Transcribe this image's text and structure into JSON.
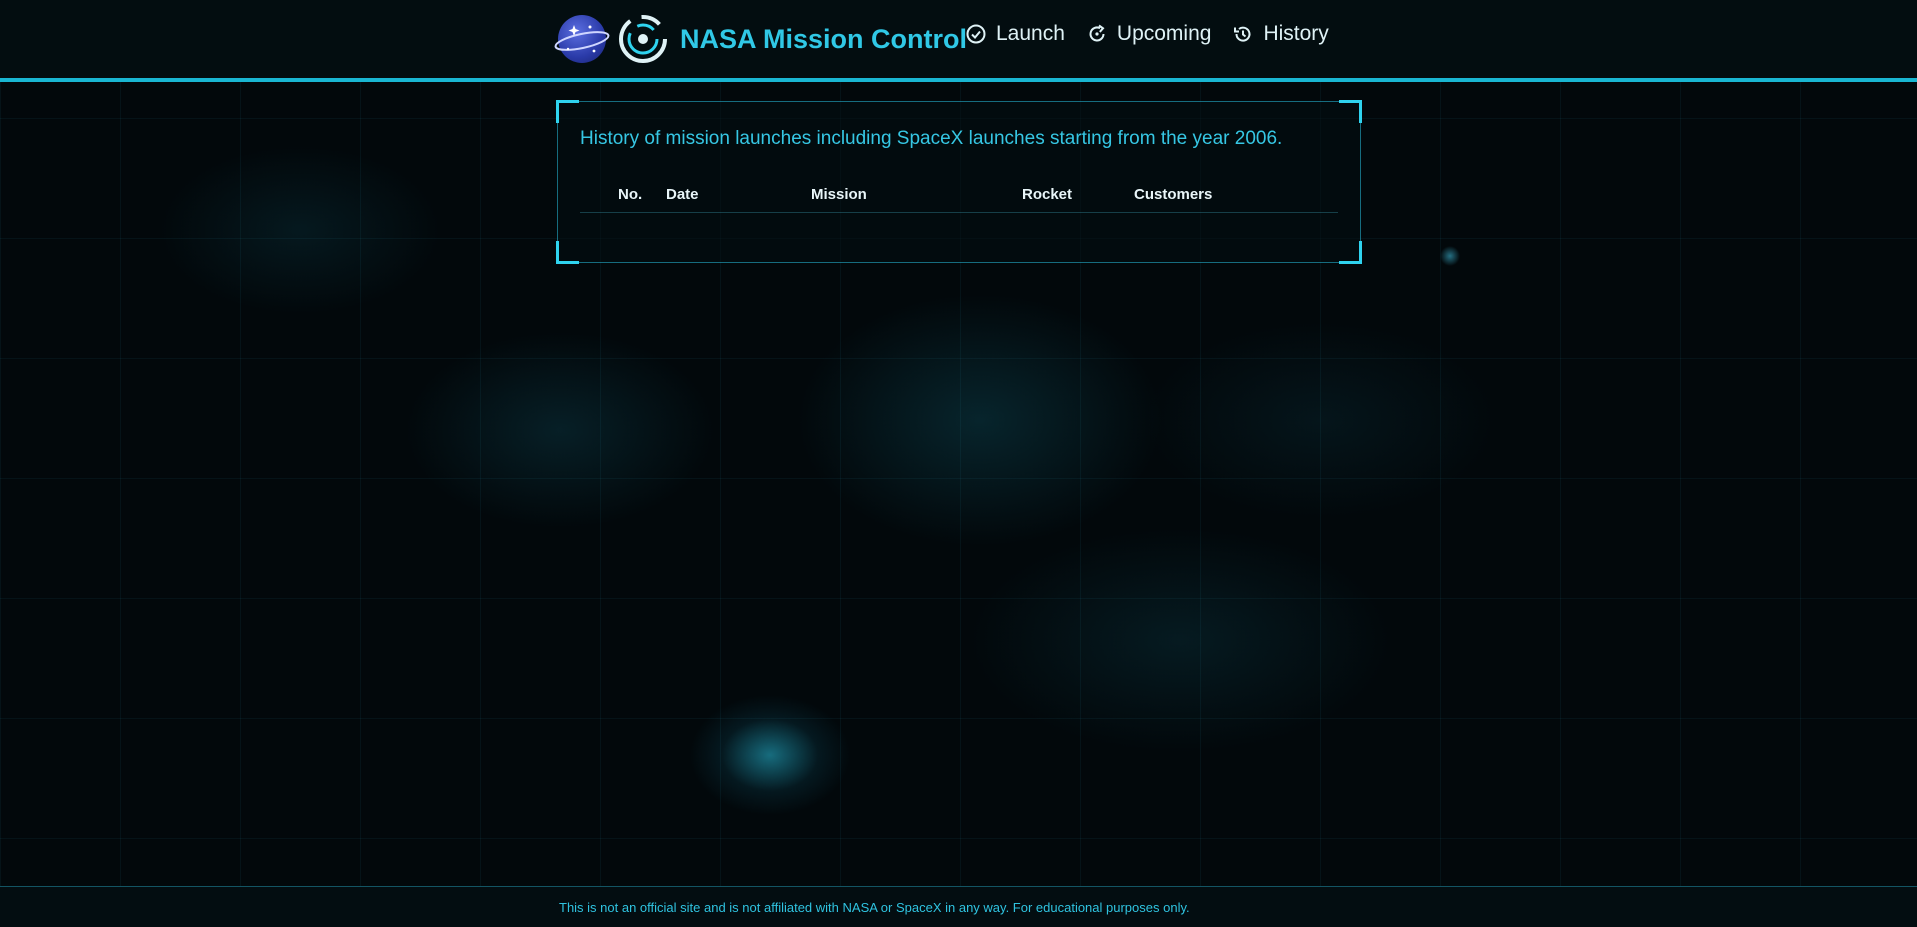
{
  "header": {
    "title": "NASA Mission Control",
    "logo_icon": "planet-icon",
    "target_icon": "target-icon",
    "nav": [
      {
        "label": "Launch",
        "icon": "check-circle-icon"
      },
      {
        "label": "Upcoming",
        "icon": "refresh-icon"
      },
      {
        "label": "History",
        "icon": "history-icon"
      }
    ]
  },
  "history_panel": {
    "description": "History of mission launches including SpaceX launches starting from the year 2006.",
    "columns": [
      "No.",
      "Date",
      "Mission",
      "Rocket",
      "Customers"
    ],
    "rows": []
  },
  "footer": {
    "text": "This is not an official site and is not affiliated with NASA or SpaceX in any way. For educational purposes only."
  },
  "colors": {
    "accent": "#19b6d2",
    "title": "#30c8e6",
    "background": "#02080b"
  }
}
